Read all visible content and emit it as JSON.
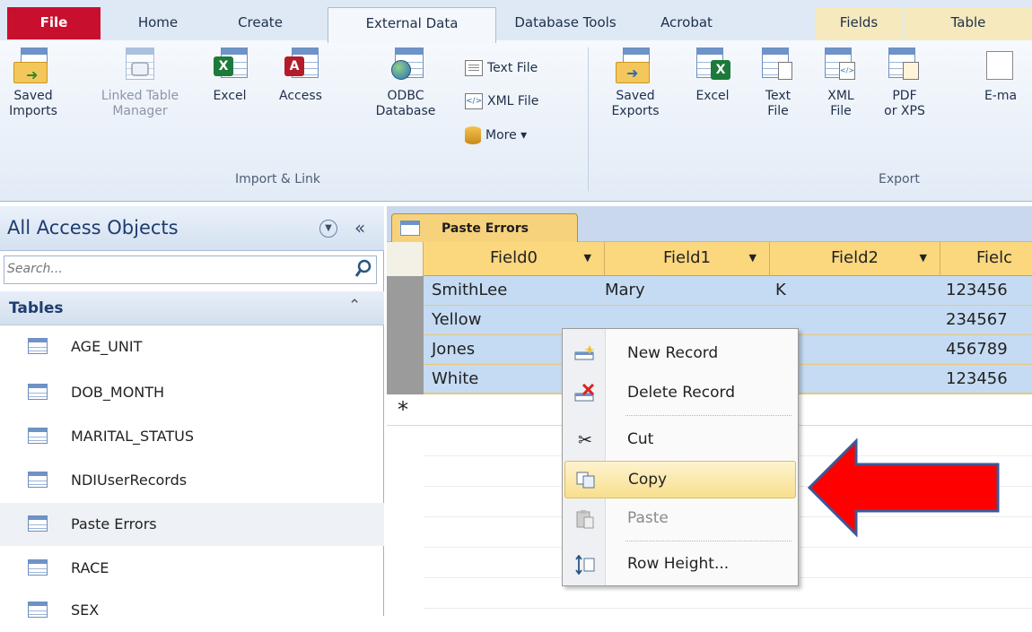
{
  "tabs": [
    {
      "label": "File"
    },
    {
      "label": "Home"
    },
    {
      "label": "Create"
    },
    {
      "label": "External Data"
    },
    {
      "label": "Database Tools"
    },
    {
      "label": "Acrobat"
    },
    {
      "label": "Fields"
    },
    {
      "label": "Table"
    }
  ],
  "ribbon": {
    "import": {
      "saved_imports_l1": "Saved",
      "saved_imports_l2": "Imports",
      "linked_l1": "Linked Table",
      "linked_l2": "Manager",
      "excel": "Excel",
      "access": "Access",
      "odbc_l1": "ODBC",
      "odbc_l2": "Database",
      "text_file": "Text File",
      "xml_file": "XML File",
      "more": "More ▾",
      "group_label": "Import & Link"
    },
    "export": {
      "saved_exports_l1": "Saved",
      "saved_exports_l2": "Exports",
      "excel": "Excel",
      "text_l1": "Text",
      "text_l2": "File",
      "xml_l1": "XML",
      "xml_l2": "File",
      "pdf_l1": "PDF",
      "pdf_l2": "or XPS",
      "email": "E-ma",
      "group_label": "Export"
    }
  },
  "nav": {
    "title": "All Access Objects",
    "search_placeholder": "Search...",
    "section": "Tables",
    "items": [
      "AGE_UNIT",
      "DOB_MONTH",
      "MARITAL_STATUS",
      "NDIUserRecords",
      "Paste Errors",
      "RACE",
      "SEX"
    ]
  },
  "document": {
    "tab_label": "Paste Errors",
    "columns": [
      "Field0",
      "Field1",
      "Field2",
      "Fielc"
    ],
    "rows": [
      [
        "SmithLee",
        "Mary",
        "K",
        "123456"
      ],
      [
        "Yellow",
        "",
        "",
        "234567"
      ],
      [
        "Jones",
        "",
        "",
        "456789"
      ],
      [
        "White",
        "",
        "",
        "123456"
      ]
    ],
    "new_row_marker": "*"
  },
  "context_menu": {
    "items": [
      {
        "label": "New Record",
        "icon": "new-record-icon"
      },
      {
        "label": "Delete Record",
        "icon": "delete-record-icon"
      },
      {
        "label": "Cut",
        "icon": "scissors-icon"
      },
      {
        "label": "Copy",
        "icon": "copy-icon",
        "highlighted": true
      },
      {
        "label": "Paste",
        "icon": "paste-icon",
        "disabled": true
      },
      {
        "label": "Row Height...",
        "icon": "row-height-icon"
      }
    ]
  },
  "colors": {
    "file_tab": "#c8102e",
    "header_gold": "#fbd77e",
    "row_selected": "#c5dbf3",
    "arrow": "#ff0000",
    "arrow_outline": "#3b5899"
  }
}
